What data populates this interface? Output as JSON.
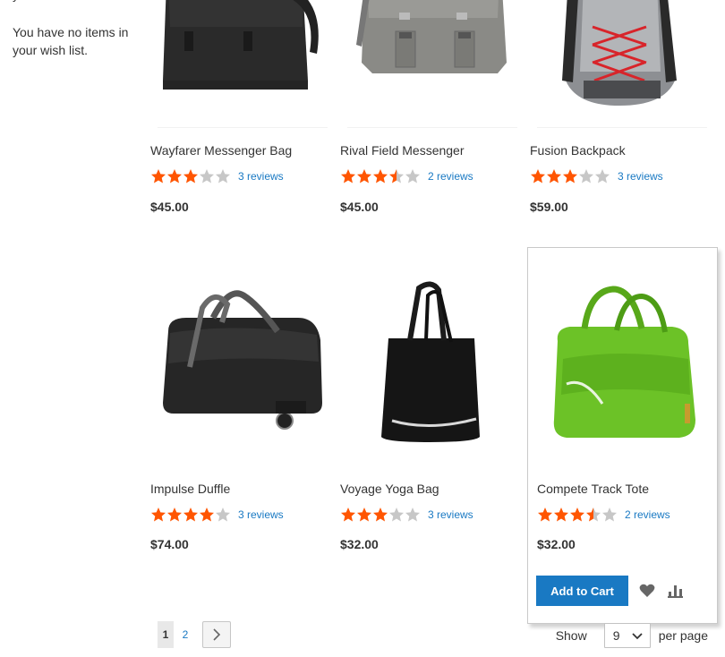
{
  "sidebar": {
    "wishlist_empty": "You have no items in your wish list."
  },
  "products": [
    {
      "name": "Wayfarer Messenger Bag",
      "rating_fraction": 0.6,
      "reviews": "3 reviews",
      "price": "$45.00"
    },
    {
      "name": "Rival Field Messenger",
      "rating_fraction": 0.7,
      "reviews": "2 reviews",
      "price": "$45.00"
    },
    {
      "name": "Fusion Backpack",
      "rating_fraction": 0.6,
      "reviews": "3 reviews",
      "price": "$59.00"
    },
    {
      "name": "Impulse Duffle",
      "rating_fraction": 0.8,
      "reviews": "3 reviews",
      "price": "$74.00"
    },
    {
      "name": "Voyage Yoga Bag",
      "rating_fraction": 0.6,
      "reviews": "3 reviews",
      "price": "$32.00"
    },
    {
      "name": "Compete Track Tote",
      "rating_fraction": 0.7,
      "reviews": "2 reviews",
      "price": "$32.00"
    }
  ],
  "hover_actions": {
    "add_to_cart": "Add to Cart",
    "wishlist_icon": "heart-icon",
    "compare_icon": "compare-bars-icon"
  },
  "pager": {
    "current_page": "1",
    "next_page": "2"
  },
  "limiter": {
    "show_label": "Show",
    "value": "9",
    "suffix": "per page"
  },
  "colors": {
    "star_filled": "#ff5501",
    "star_empty": "#c7c7c7",
    "link": "#1979c3",
    "button": "#1979c3",
    "bag_green": "#6cc227"
  }
}
